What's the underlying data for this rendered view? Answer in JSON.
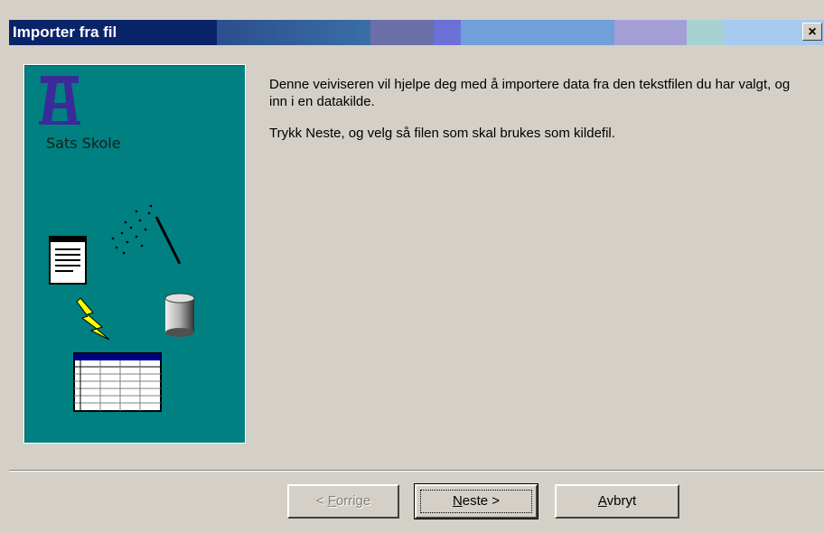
{
  "window": {
    "title": "Importer fra fil",
    "close_glyph": "×"
  },
  "side_panel": {
    "logo_text": "Sats Skole",
    "icons": [
      "logo-icon",
      "notepad-icon",
      "magic-wand-icon",
      "lightning-icon",
      "database-icon",
      "table-icon"
    ],
    "background_color": "#008080"
  },
  "content": {
    "paragraph1": "Denne veiviseren vil hjelpe deg med å importere data fra den tekstfilen du har valgt, og inn i en datakilde.",
    "paragraph2": "Trykk Neste, og velg så filen som skal brukes som kildefil."
  },
  "buttons": {
    "prev": {
      "prefix": "< ",
      "accel": "F",
      "rest": "orrige",
      "enabled": false
    },
    "next": {
      "accel": "N",
      "rest": "este >",
      "enabled": true,
      "default": true
    },
    "cancel": {
      "accel": "A",
      "rest": "vbryt",
      "enabled": true
    }
  },
  "colors": {
    "titlebar_start": "#0a246a",
    "dialog_bg": "#d4d0c8",
    "panel_bg": "#008080"
  }
}
